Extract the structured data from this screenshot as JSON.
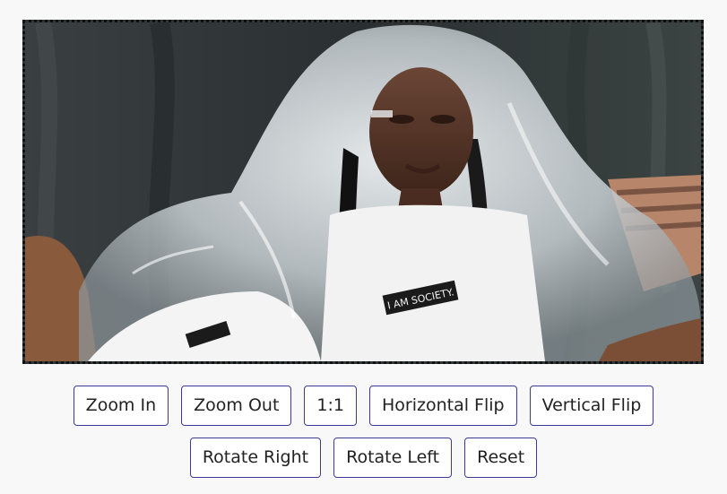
{
  "viewer": {
    "image_label": "Photo of person under clear plastic sheet",
    "shirt_text": "I AM SOCIETY.",
    "border_color": "#111111"
  },
  "toolbar": {
    "row1": [
      {
        "id": "zoom-in",
        "label": "Zoom In"
      },
      {
        "id": "zoom-out",
        "label": "Zoom Out"
      },
      {
        "id": "one-to-one",
        "label": "1:1"
      },
      {
        "id": "horizontal-flip",
        "label": "Horizontal Flip"
      },
      {
        "id": "vertical-flip",
        "label": "Vertical Flip"
      }
    ],
    "row2": [
      {
        "id": "rotate-right",
        "label": "Rotate Right"
      },
      {
        "id": "rotate-left",
        "label": "Rotate Left"
      },
      {
        "id": "reset",
        "label": "Reset"
      }
    ],
    "button_border_color": "#3b3b9a"
  }
}
